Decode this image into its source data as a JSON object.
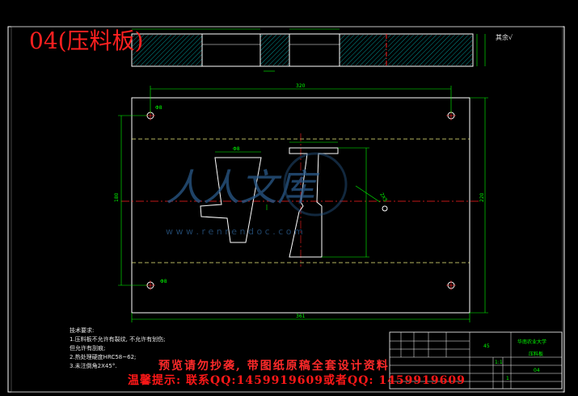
{
  "drawing": {
    "title": "04(压料板)",
    "roughness_symbol": "其余√",
    "tech_requirements": {
      "heading": "技术要求:",
      "items": [
        "1.压料板不允许有裂纹, 不允许有划伤;",
        "  但允许有刮痕;",
        "2.热处理硬度HRC58~62;",
        "3.未注倒角2X45°."
      ]
    },
    "dimensions": {
      "top_width": "320",
      "bottom_width": "361",
      "left_height": "180",
      "right_height": "220",
      "cutout_width": "Φ8",
      "hole_top_left": "Φ8",
      "hole_bottom_left": "Φ8",
      "slot_label": "2X5"
    },
    "title_block": {
      "school": "华南农业大学",
      "part_name": "压料板",
      "material": "45",
      "scale": "1:1",
      "sheet": "1",
      "drawing_no": "04"
    },
    "watermark": {
      "line1": "预览请勿抄袭, 带图纸原稿全套设计资料",
      "line2": "温馨提示: 联系QQ:1459919609或者QQ: 1459919609",
      "site": "w w w . r e n r e n d o c . c o m",
      "logo": "人人文库"
    },
    "colors": {
      "background": "#000000",
      "outline": "#ffffff",
      "dimension": "#00ff00",
      "centerline": "#ff0000",
      "hatch": "#00ffff",
      "title_red": "#ff2020",
      "watermark_blue": "#2a5a8a"
    }
  }
}
